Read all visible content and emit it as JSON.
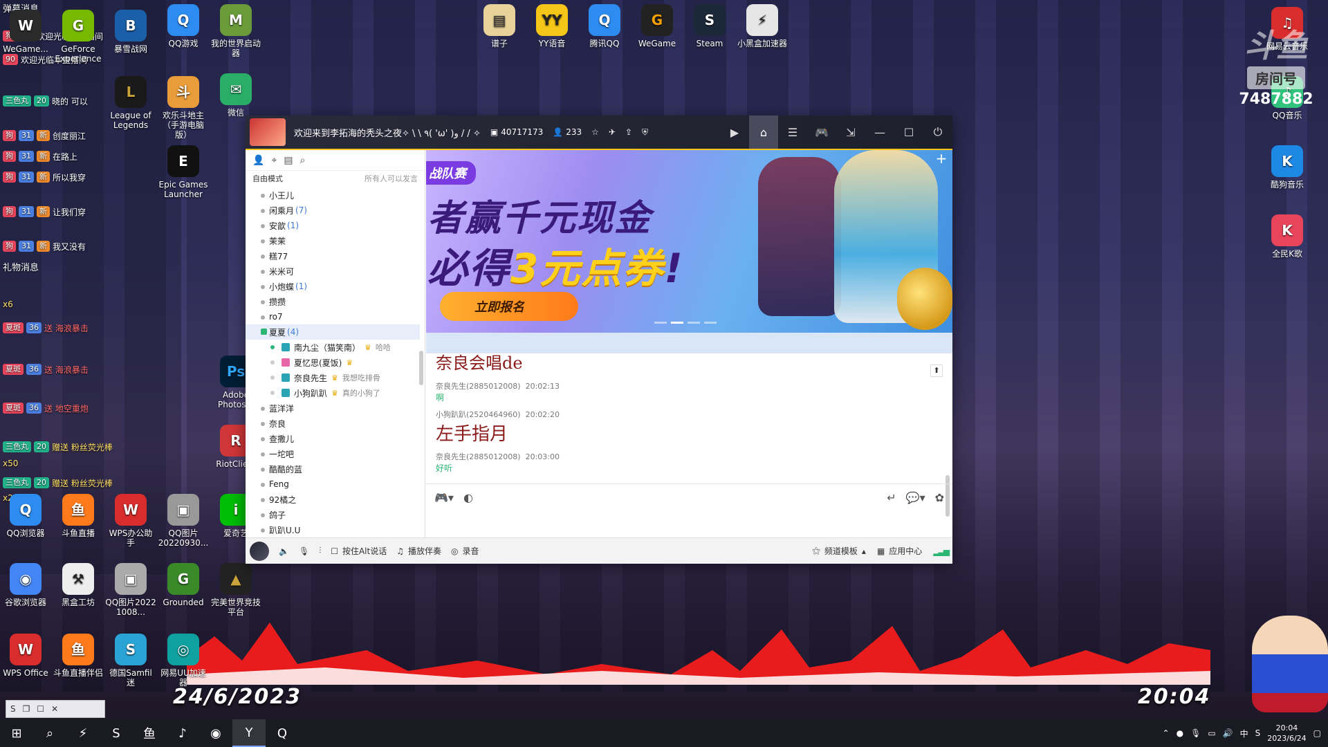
{
  "overlay": {
    "title_top": "弹幕消息",
    "title_gift": "礼物消息",
    "lines": [
      {
        "badges": [
          "狗",
          "44"
        ],
        "text": "欢迎光临本直播间"
      },
      {
        "badges": [
          "90"
        ],
        "text": "欢迎光临本直播间"
      },
      {
        "badges": [
          "三色丸",
          "20"
        ],
        "text": "晓的 可以"
      },
      {
        "badges": [
          "狗",
          "31",
          "新"
        ],
        "text": "创度丽江"
      },
      {
        "badges": [
          "狗",
          "31",
          "新"
        ],
        "text": "在路上"
      },
      {
        "badges": [
          "狗",
          "31",
          "新"
        ],
        "text": "所以我穿"
      },
      {
        "badges": [
          "狗",
          "31",
          "新"
        ],
        "text": "让我们穿"
      },
      {
        "badges": [
          "狗",
          "31",
          "新"
        ],
        "text": "我又没有"
      }
    ],
    "gift_lines": [
      {
        "badges": [
          "夏斑",
          "36"
        ],
        "text": "送 海浪暴击"
      },
      {
        "badges": [
          "夏斑",
          "36"
        ],
        "text": "送 海浪暴击"
      },
      {
        "badges": [
          "夏斑",
          "36"
        ],
        "text": "送 地空重炮"
      },
      {
        "badges": [
          "三色丸",
          "20"
        ],
        "text": "赠送 粉丝荧光棒"
      },
      {
        "badges": [
          "三色丸",
          "20"
        ],
        "text": "赠送 粉丝荧光棒"
      }
    ],
    "counts": [
      "x6",
      "x50",
      "x20"
    ]
  },
  "desktop_icons": [
    {
      "label": "WeGame...",
      "col": "#2a2a2a"
    },
    {
      "label": "GeForce Experience",
      "col": "#76b900"
    },
    {
      "label": "暴雪战网",
      "col": "#1a5fa8"
    },
    {
      "label": "QQ游戏",
      "col": "#2d8cf0"
    },
    {
      "label": "我的世界启动器",
      "col": "#6a9b3a"
    },
    {
      "label": "谱子",
      "col": "#e8d29a"
    },
    {
      "label": "YY语音",
      "col": "#f5c518"
    },
    {
      "label": "腾讯QQ",
      "col": "#2d8cf0"
    },
    {
      "label": "WeGame",
      "col": "#222"
    },
    {
      "label": "Steam",
      "col": "#1b2838"
    },
    {
      "label": "小黑盒加速器",
      "col": "#e6e6e6"
    },
    {
      "label": "网易云音乐",
      "col": "#d92d2d"
    },
    {
      "label": "QQ音乐",
      "col": "#31c27c"
    },
    {
      "label": "酷狗音乐",
      "col": "#1e88e5"
    },
    {
      "label": "全民K歌",
      "col": "#e8455a"
    },
    {
      "label": "微信",
      "col": "#2aae67"
    },
    {
      "label": "League of Legends",
      "col": "#1a1a1a"
    },
    {
      "label": "欢乐斗地主（手游电脑版）",
      "col": "#e89c3a"
    },
    {
      "label": "Epic Games Launcher",
      "col": "#111"
    },
    {
      "label": "QQ浏览器",
      "col": "#2d8cf0"
    },
    {
      "label": "斗鱼直播",
      "col": "#ff7a1a"
    },
    {
      "label": "WPS办公助手",
      "col": "#d92d2d"
    },
    {
      "label": "QQ图片20220930...",
      "col": "#999"
    },
    {
      "label": "爱奇艺",
      "col": "#00be06"
    },
    {
      "label": "谷歌浏览器",
      "col": "#4285f4"
    },
    {
      "label": "黑盒工坊",
      "col": "#eee"
    },
    {
      "label": "QQ图片2022 1008...",
      "col": "#aaa"
    },
    {
      "label": "Grounded",
      "col": "#3a8a2a"
    },
    {
      "label": "完美世界竞技平台",
      "col": "#222"
    },
    {
      "label": "WPS Office",
      "col": "#d92d2d"
    },
    {
      "label": "斗鱼直播伴侣",
      "col": "#ff7a1a"
    },
    {
      "label": "德国Samfil 迷",
      "col": "#2aa3d5"
    },
    {
      "label": "网易UU加速器",
      "col": "#0fa0a0"
    },
    {
      "label": "RiotClie...",
      "col": "#d13639"
    },
    {
      "label": "Adobe Photos...",
      "col": "#001e36"
    }
  ],
  "window": {
    "title": "欢迎来到李拓海的秃头之夜✧ \\ \\ ٩( 'ω' )و / / ✧",
    "room_id": "40717173",
    "online_count": "233",
    "left": {
      "mode": "自由模式",
      "mode_right": "所有人可以发言",
      "channels_before": [
        {
          "name": "小王儿",
          "count": ""
        },
        {
          "name": "闲乘月",
          "count": "(7)"
        },
        {
          "name": "安歆",
          "count": "(1)"
        },
        {
          "name": "茉茉",
          "count": ""
        },
        {
          "name": "糕77",
          "count": ""
        },
        {
          "name": "米米可",
          "count": ""
        },
        {
          "name": "小炮蝶",
          "count": "(1)"
        },
        {
          "name": "攒攒",
          "count": ""
        },
        {
          "name": "ro7",
          "count": ""
        }
      ],
      "selected": {
        "name": "夏夏",
        "count": "(4)"
      },
      "users": [
        {
          "name": "南九尘（猫笑南）",
          "note": "哈哈",
          "online": true,
          "pink": false
        },
        {
          "name": "夏忆思(夏饭)",
          "note": "",
          "online": false,
          "pink": true
        },
        {
          "name": "奈良先生",
          "note": "我想吃排骨",
          "online": false,
          "pink": false
        },
        {
          "name": "小狗趴趴",
          "note": "真的小狗了",
          "online": false,
          "pink": false
        }
      ],
      "channels_after": [
        "蓝洋洋",
        "奈良",
        "查撒儿",
        "一坨吧",
        "酷酷的蓝",
        "Feng",
        "92橘之",
        "鸽子",
        "趴趴U.U"
      ]
    },
    "banner": {
      "tag": "战队赛",
      "line1": "者赢千元现金",
      "line2_a": "必得",
      "line2_hl": "3元点券",
      "line2_b": "!",
      "button": "立即报名"
    },
    "chat": {
      "first_line": "奈良会唱de",
      "messages": [
        {
          "sender": "奈良先生(2885012008)",
          "time": "20:02:13",
          "text": "啊",
          "big": false
        },
        {
          "sender": "小狗趴趴(2520464960)",
          "time": "20:02:20",
          "text": "左手指月",
          "big": true
        },
        {
          "sender": "奈良先生(2885012008)",
          "time": "20:03:00",
          "text": "好听",
          "big": false
        }
      ]
    },
    "bottom": {
      "push_to_talk": "按住Alt说话",
      "accompany": "播放伴奏",
      "record": "录音",
      "template": "频道模板",
      "app_center": "应用中心"
    }
  },
  "overlay_date": "24/6/2023",
  "overlay_time": "20:04",
  "room": {
    "logo": "斗鱼",
    "label": "房间号",
    "number": "7487882"
  },
  "taskbar": {
    "time": "20:04",
    "date": "2023/6/24",
    "ime": "中"
  }
}
